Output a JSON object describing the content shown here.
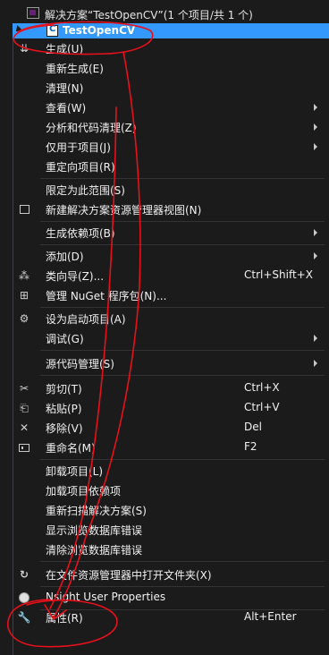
{
  "solution": {
    "title": "解决方案“TestOpenCV”(1 个项目/共 1 个)",
    "project": "TestOpenCV"
  },
  "menu": {
    "items": [
      {
        "label": "生成(U)",
        "icon": "build-icon"
      },
      {
        "label": "重新生成(E)"
      },
      {
        "label": "清理(N)"
      },
      {
        "label": "查看(W)",
        "submenu": true
      },
      {
        "label": "分析和代码清理(Z)",
        "submenu": true
      },
      {
        "label": "仅用于项目(J)",
        "submenu": true
      },
      {
        "label": "重定向项目(R)"
      },
      {
        "label": "限定为此范围(S)"
      },
      {
        "label": "新建解决方案资源管理器视图(N)",
        "icon": "new-view-icon"
      },
      {
        "label": "生成依赖项(B)",
        "submenu": true
      },
      {
        "label": "添加(D)",
        "submenu": true
      },
      {
        "label": "类向导(Z)...",
        "icon": "class-wizard-icon",
        "shortcut": "Ctrl+Shift+X"
      },
      {
        "label": "管理 NuGet 程序包(N)...",
        "icon": "nuget-icon"
      },
      {
        "label": "设为启动项目(A)",
        "icon": "gear-icon"
      },
      {
        "label": "调试(G)",
        "submenu": true
      },
      {
        "label": "源代码管理(S)",
        "submenu": true
      },
      {
        "label": "剪切(T)",
        "icon": "scissors-icon",
        "shortcut": "Ctrl+X"
      },
      {
        "label": "粘贴(P)",
        "icon": "paste-icon",
        "shortcut": "Ctrl+V"
      },
      {
        "label": "移除(V)",
        "icon": "delete-icon",
        "shortcut": "Del"
      },
      {
        "label": "重命名(M)",
        "icon": "rename-icon",
        "shortcut": "F2"
      },
      {
        "label": "卸载项目(L)"
      },
      {
        "label": "加载项目依赖项"
      },
      {
        "label": "重新扫描解决方案(S)"
      },
      {
        "label": "显示浏览数据库错误"
      },
      {
        "label": "清除浏览数据库错误"
      },
      {
        "label": "在文件资源管理器中打开文件夹(X)",
        "icon": "refresh-icon"
      },
      {
        "label": "Nsight User Properties",
        "icon": "globe-icon"
      },
      {
        "label": "属性(R)",
        "icon": "wrench-icon",
        "shortcut": "Alt+Enter"
      }
    ]
  },
  "colors": {
    "background": "#1b1b1c",
    "selection": "#3399ff",
    "annotation": "#e8101a"
  }
}
